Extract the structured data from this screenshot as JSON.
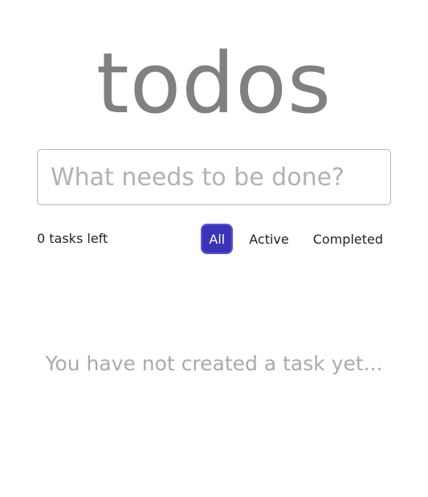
{
  "header": {
    "title": "todos"
  },
  "new_task": {
    "placeholder": "What needs to be done?",
    "value": ""
  },
  "footer": {
    "tasks_left": "0 tasks left",
    "filters": [
      {
        "label": "All",
        "active": true
      },
      {
        "label": "Active",
        "active": false
      },
      {
        "label": "Completed",
        "active": false
      }
    ]
  },
  "main": {
    "empty_message": "You have not created a task yet..."
  },
  "colors": {
    "active_filter_bg": "#3a33b8",
    "title": "#808080",
    "muted_text": "#aaaaaa"
  }
}
